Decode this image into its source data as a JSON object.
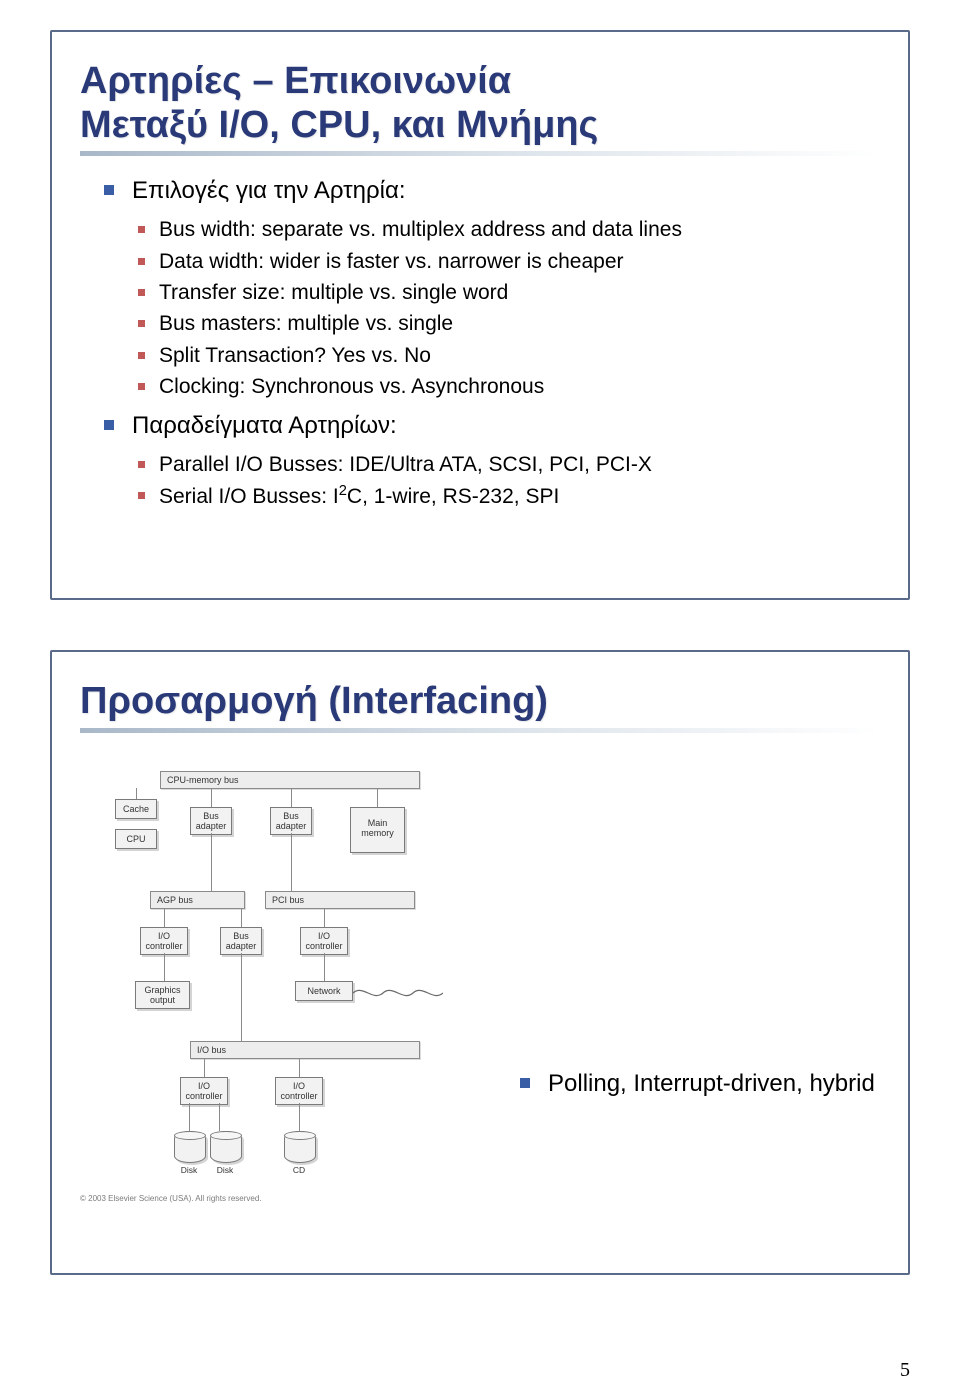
{
  "slide1": {
    "title_line1": "Αρτηρίες – Επικοινωνία",
    "title_line2": "Μεταξύ I/O, CPU, και Μνήμης",
    "l1_a": "Επιλογές για την Αρτηρία:",
    "sub_a1": "Bus width: separate vs. multiplex address and data lines",
    "sub_a2": "Data width: wider is faster vs. narrower is cheaper",
    "sub_a3": "Transfer size: multiple vs. single word",
    "sub_a4": "Bus masters: multiple vs. single",
    "sub_a5": "Split Transaction? Yes vs. No",
    "sub_a6": "Clocking: Synchronous vs. Asynchronous",
    "l1_b": "Παραδείγματα Αρτηρίων:",
    "sub_b1_pre": "Parallel I/O Busses: IDE/Ultra ATA, SCSI, PCI, PCI-X",
    "sub_b2_pre": "Serial I/O Busses: I",
    "sub_b2_sup": "2",
    "sub_b2_post": "C, 1-wire, RS-232, SPI"
  },
  "slide2": {
    "title": "Προσαρμογή (Interfacing)",
    "right_bullet": "Polling, Interrupt-driven, hybrid",
    "diagram": {
      "cpu_memory_bus": "CPU-memory bus",
      "cache": "Cache",
      "cpu": "CPU",
      "bus_adapter": "Bus adapter",
      "main_memory": "Main memory",
      "agp_bus": "AGP bus",
      "pci_bus": "PCI bus",
      "io_controller": "I/O controller",
      "graphics_output": "Graphics output",
      "network": "Network",
      "io_bus": "I/O bus",
      "disk": "Disk",
      "cd": "CD",
      "copyright": "© 2003 Elsevier Science (USA). All rights reserved."
    }
  },
  "page_number": "5"
}
